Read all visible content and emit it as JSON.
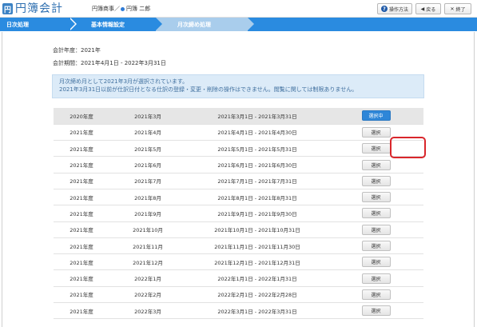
{
  "header": {
    "logo_text": "円簿会計",
    "logo_badge": "円",
    "company": "円簿商事",
    "separator": "／",
    "user": "円簿 二郎",
    "help_label": "操作方法",
    "back_label": "戻る",
    "exit_label": "終了"
  },
  "nav": {
    "items": [
      {
        "label": "日次処理"
      },
      {
        "label": "基本情報設定"
      },
      {
        "label": "月次締め処理"
      }
    ],
    "color": "#2a8be0",
    "active_color": "#a9cdec"
  },
  "info": {
    "fiscal_year": "会計年度：2021年",
    "fiscal_period": "会計期間：2021年4月1日 - 2022年3月31日"
  },
  "notice": {
    "line1": "月次締め月として2021年3月が選択されています。",
    "line2": "2021年3月31日以前が仕訳日付となる仕訳の登録・変更・削除の操作はできません。閲覧に関しては制限ありません。"
  },
  "table": {
    "rows": [
      {
        "fy": "2020年度",
        "month": "2021年3月",
        "range": "2021年3月1日 - 2021年3月31日",
        "action": "選択中",
        "selected": true
      },
      {
        "fy": "2021年度",
        "month": "2021年4月",
        "range": "2021年4月1日 - 2021年4月30日",
        "action": "選択",
        "selected": false
      },
      {
        "fy": "2021年度",
        "month": "2021年5月",
        "range": "2021年5月1日 - 2021年5月31日",
        "action": "選択",
        "selected": false
      },
      {
        "fy": "2021年度",
        "month": "2021年6月",
        "range": "2021年6月1日 - 2021年6月30日",
        "action": "選択",
        "selected": false
      },
      {
        "fy": "2021年度",
        "month": "2021年7月",
        "range": "2021年7月1日 - 2021年7月31日",
        "action": "選択",
        "selected": false
      },
      {
        "fy": "2021年度",
        "month": "2021年8月",
        "range": "2021年8月1日 - 2021年8月31日",
        "action": "選択",
        "selected": false
      },
      {
        "fy": "2021年度",
        "month": "2021年9月",
        "range": "2021年9月1日 - 2021年9月30日",
        "action": "選択",
        "selected": false
      },
      {
        "fy": "2021年度",
        "month": "2021年10月",
        "range": "2021年10月1日 - 2021年10月31日",
        "action": "選択",
        "selected": false
      },
      {
        "fy": "2021年度",
        "month": "2021年11月",
        "range": "2021年11月1日 - 2021年11月30日",
        "action": "選択",
        "selected": false
      },
      {
        "fy": "2021年度",
        "month": "2021年12月",
        "range": "2021年12月1日 - 2021年12月31日",
        "action": "選択",
        "selected": false
      },
      {
        "fy": "2021年度",
        "month": "2022年1月",
        "range": "2022年1月1日 - 2022年1月31日",
        "action": "選択",
        "selected": false
      },
      {
        "fy": "2021年度",
        "month": "2022年2月",
        "range": "2022年2月1日 - 2022年2月28日",
        "action": "選択",
        "selected": false
      },
      {
        "fy": "2021年度",
        "month": "2022年3月",
        "range": "2022年3月1日 - 2022年3月31日",
        "action": "選択",
        "selected": false
      }
    ]
  },
  "highlight_color": "#d9262b"
}
